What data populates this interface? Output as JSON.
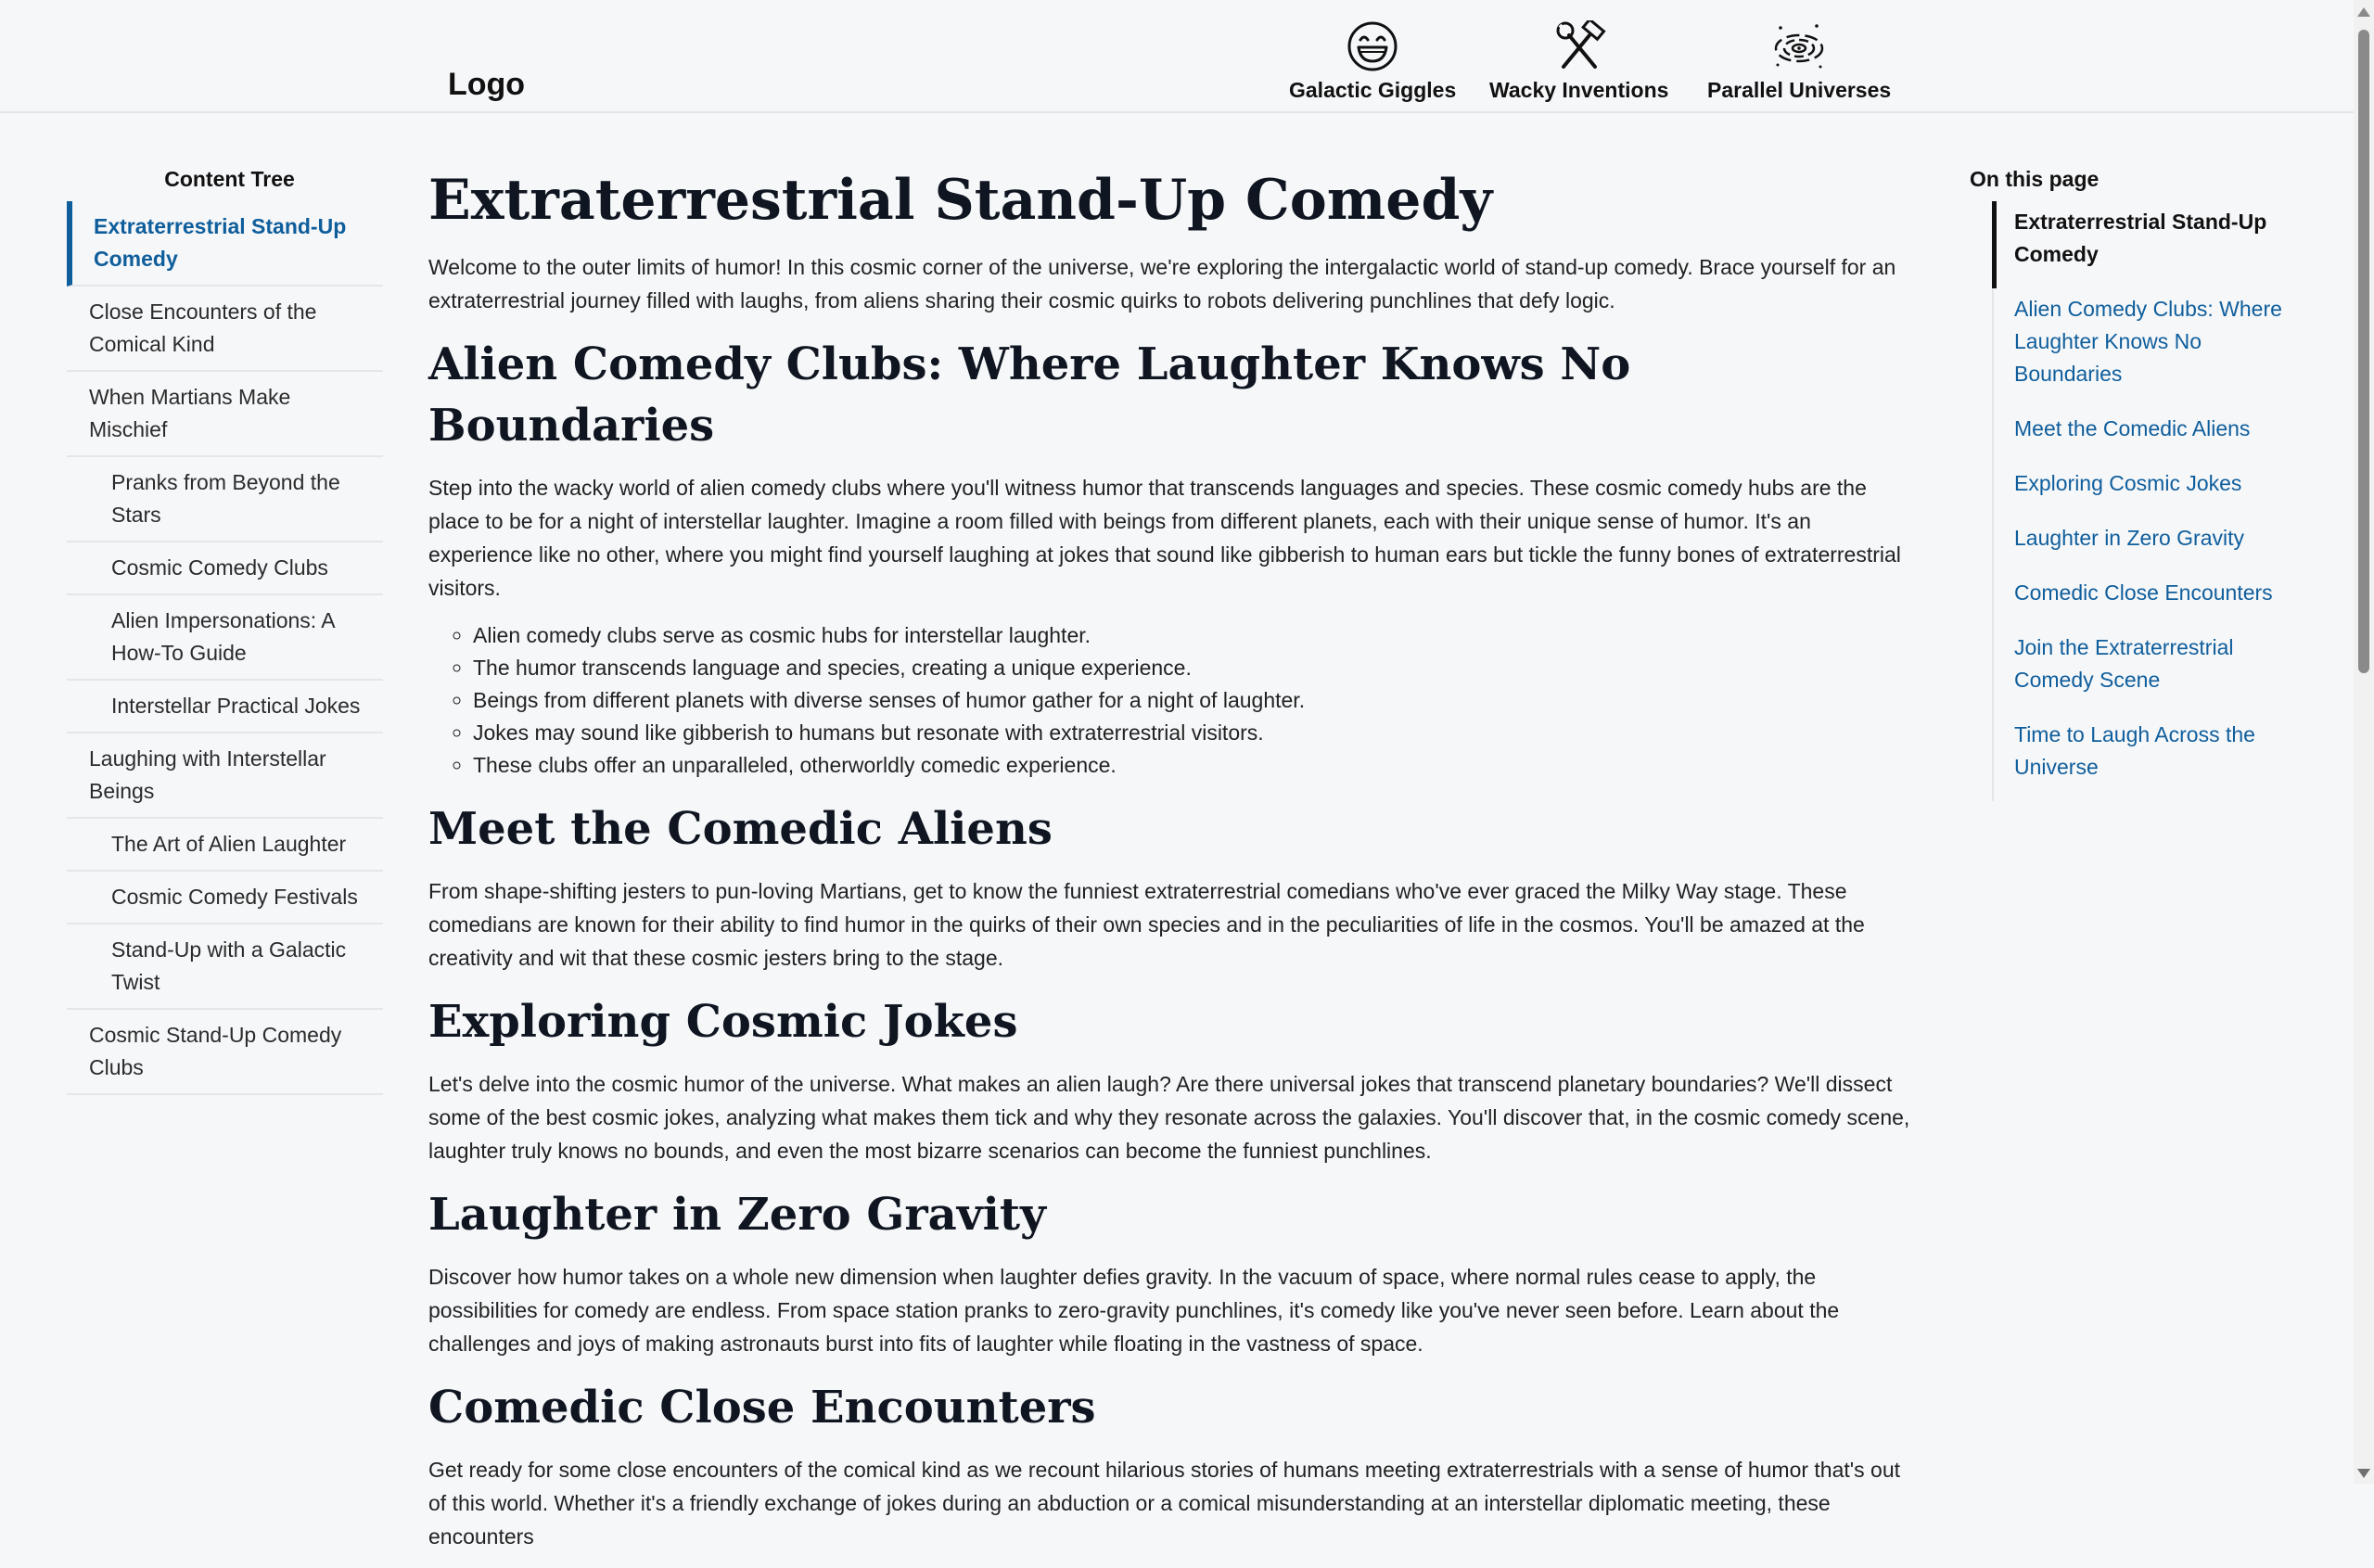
{
  "header": {
    "logo": "Logo",
    "nav": [
      {
        "label": "Galactic Giggles",
        "icon": "laughing-face-icon"
      },
      {
        "label": "Wacky Inventions",
        "icon": "hammer-wrench-icon"
      },
      {
        "label": "Parallel Universes",
        "icon": "galaxy-icon"
      }
    ]
  },
  "sidebar": {
    "title": "Content Tree",
    "items": [
      {
        "label": "Extraterrestrial Stand-Up Comedy",
        "level": 1,
        "active": true
      },
      {
        "label": "Close Encounters of the Comical Kind",
        "level": 1
      },
      {
        "label": "When Martians Make Mischief",
        "level": 1
      },
      {
        "label": "Pranks from Beyond the Stars",
        "level": 2
      },
      {
        "label": "Cosmic Comedy Clubs",
        "level": 2
      },
      {
        "label": "Alien Impersonations: A How-To Guide",
        "level": 2
      },
      {
        "label": "Interstellar Practical Jokes",
        "level": 2
      },
      {
        "label": "Laughing with Interstellar Beings",
        "level": 1
      },
      {
        "label": "The Art of Alien Laughter",
        "level": 2
      },
      {
        "label": "Cosmic Comedy Festivals",
        "level": 2
      },
      {
        "label": "Stand-Up with a Galactic Twist",
        "level": 2
      },
      {
        "label": "Cosmic Stand-Up Comedy Clubs",
        "level": 1
      }
    ]
  },
  "main": {
    "title": "Extraterrestrial Stand-Up Comedy",
    "intro": "Welcome to the outer limits of humor! In this cosmic corner of the universe, we're exploring the intergalactic world of stand-up comedy. Brace yourself for an extraterrestrial journey filled with laughs, from aliens sharing their cosmic quirks to robots delivering punchlines that defy logic.",
    "sections": [
      {
        "heading": "Alien Comedy Clubs: Where Laughter Knows No Boundaries",
        "text": "Step into the wacky world of alien comedy clubs where you'll witness humor that transcends languages and species. These cosmic comedy hubs are the place to be for a night of interstellar laughter. Imagine a room filled with beings from different planets, each with their unique sense of humor. It's an experience like no other, where you might find yourself laughing at jokes that sound like gibberish to human ears but tickle the funny bones of extraterrestrial visitors.",
        "bullets": [
          "Alien comedy clubs serve as cosmic hubs for interstellar laughter.",
          "The humor transcends language and species, creating a unique experience.",
          "Beings from different planets with diverse senses of humor gather for a night of laughter.",
          "Jokes may sound like gibberish to humans but resonate with extraterrestrial visitors.",
          "These clubs offer an unparalleled, otherworldly comedic experience."
        ]
      },
      {
        "heading": "Meet the Comedic Aliens",
        "text": "From shape-shifting jesters to pun-loving Martians, get to know the funniest extraterrestrial comedians who've ever graced the Milky Way stage. These comedians are known for their ability to find humor in the quirks of their own species and in the peculiarities of life in the cosmos. You'll be amazed at the creativity and wit that these cosmic jesters bring to the stage."
      },
      {
        "heading": "Exploring Cosmic Jokes",
        "text": "Let's delve into the cosmic humor of the universe. What makes an alien laugh? Are there universal jokes that transcend planetary boundaries? We'll dissect some of the best cosmic jokes, analyzing what makes them tick and why they resonate across the galaxies. You'll discover that, in the cosmic comedy scene, laughter truly knows no bounds, and even the most bizarre scenarios can become the funniest punchlines."
      },
      {
        "heading": "Laughter in Zero Gravity",
        "text": "Discover how humor takes on a whole new dimension when laughter defies gravity. In the vacuum of space, where normal rules cease to apply, the possibilities for comedy are endless. From space station pranks to zero-gravity punchlines, it's comedy like you've never seen before. Learn about the challenges and joys of making astronauts burst into fits of laughter while floating in the vastness of space."
      },
      {
        "heading": "Comedic Close Encounters",
        "text": "Get ready for some close encounters of the comical kind as we recount hilarious stories of humans meeting extraterrestrials with a sense of humor that's out of this world. Whether it's a friendly exchange of jokes during an abduction or a comical misunderstanding at an interstellar diplomatic meeting, these encounters"
      }
    ]
  },
  "toc": {
    "title": "On this page",
    "items": [
      {
        "label": "Extraterrestrial Stand-Up Comedy",
        "active": true
      },
      {
        "label": "Alien Comedy Clubs: Where Laughter Knows No Boundaries"
      },
      {
        "label": "Meet the Comedic Aliens"
      },
      {
        "label": "Exploring Cosmic Jokes"
      },
      {
        "label": "Laughter in Zero Gravity"
      },
      {
        "label": "Comedic Close Encounters"
      },
      {
        "label": "Join the Extraterrestrial Comedy Scene"
      },
      {
        "label": "Time to Laugh Across the Universe"
      }
    ]
  },
  "colors": {
    "background": "#f6f7f9",
    "link": "#0f5e9c",
    "heading": "#101621",
    "divider": "#e4e6ea"
  }
}
